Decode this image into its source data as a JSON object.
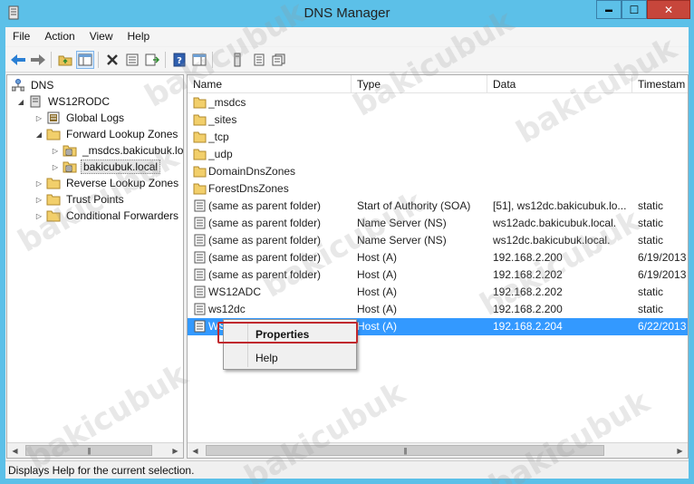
{
  "window": {
    "title": "DNS Manager",
    "min": "▬",
    "max": "☐",
    "close": "✕"
  },
  "menubar": [
    "File",
    "Action",
    "View",
    "Help"
  ],
  "tree": {
    "root": "DNS",
    "server": "WS12RODC",
    "items": [
      {
        "label": "Global Logs",
        "level": 2,
        "toggle": "▷"
      },
      {
        "label": "Forward Lookup Zones",
        "level": 2,
        "toggle": "◢"
      },
      {
        "label": "_msdcs.bakicubuk.lo",
        "level": 3,
        "toggle": "▷"
      },
      {
        "label": "bakicubuk.local",
        "level": 3,
        "toggle": "▷",
        "selected": true
      },
      {
        "label": "Reverse Lookup Zones",
        "level": 2,
        "toggle": "▷"
      },
      {
        "label": "Trust Points",
        "level": 2,
        "toggle": "▷"
      },
      {
        "label": "Conditional Forwarders",
        "level": 2,
        "toggle": "▷"
      }
    ]
  },
  "list": {
    "columns": [
      "Name",
      "Type",
      "Data",
      "Timestam"
    ],
    "rows": [
      {
        "name": "_msdcs",
        "type": "",
        "data": "",
        "ts": "",
        "icon": "folder"
      },
      {
        "name": "_sites",
        "type": "",
        "data": "",
        "ts": "",
        "icon": "folder"
      },
      {
        "name": "_tcp",
        "type": "",
        "data": "",
        "ts": "",
        "icon": "folder"
      },
      {
        "name": "_udp",
        "type": "",
        "data": "",
        "ts": "",
        "icon": "folder"
      },
      {
        "name": "DomainDnsZones",
        "type": "",
        "data": "",
        "ts": "",
        "icon": "folder"
      },
      {
        "name": "ForestDnsZones",
        "type": "",
        "data": "",
        "ts": "",
        "icon": "folder"
      },
      {
        "name": "(same as parent folder)",
        "type": "Start of Authority (SOA)",
        "data": "[51], ws12dc.bakicubuk.lo...",
        "ts": "static",
        "icon": "record"
      },
      {
        "name": "(same as parent folder)",
        "type": "Name Server (NS)",
        "data": "ws12adc.bakicubuk.local.",
        "ts": "static",
        "icon": "record"
      },
      {
        "name": "(same as parent folder)",
        "type": "Name Server (NS)",
        "data": "ws12dc.bakicubuk.local.",
        "ts": "static",
        "icon": "record"
      },
      {
        "name": "(same as parent folder)",
        "type": "Host (A)",
        "data": "192.168.2.200",
        "ts": "6/19/2013",
        "icon": "record"
      },
      {
        "name": "(same as parent folder)",
        "type": "Host (A)",
        "data": "192.168.2.202",
        "ts": "6/19/2013",
        "icon": "record"
      },
      {
        "name": "WS12ADC",
        "type": "Host (A)",
        "data": "192.168.2.202",
        "ts": "static",
        "icon": "record"
      },
      {
        "name": "ws12dc",
        "type": "Host (A)",
        "data": "192.168.2.200",
        "ts": "static",
        "icon": "record"
      },
      {
        "name": "WS",
        "type": "Host (A)",
        "data": "192.168.2.204",
        "ts": "6/22/2013",
        "icon": "record",
        "selected": true
      }
    ]
  },
  "context_menu": {
    "properties": "Properties",
    "help": "Help"
  },
  "status": "Displays Help for the current selection.",
  "scroll": {
    "left": "◀",
    "right": "▶",
    "thumb": "|||"
  },
  "watermark": "bakicubuk",
  "colors": {
    "titlebar": "#5cc0e8",
    "selection": "#3399ff",
    "close": "#c7463b",
    "highlight_box": "#c0282d"
  }
}
